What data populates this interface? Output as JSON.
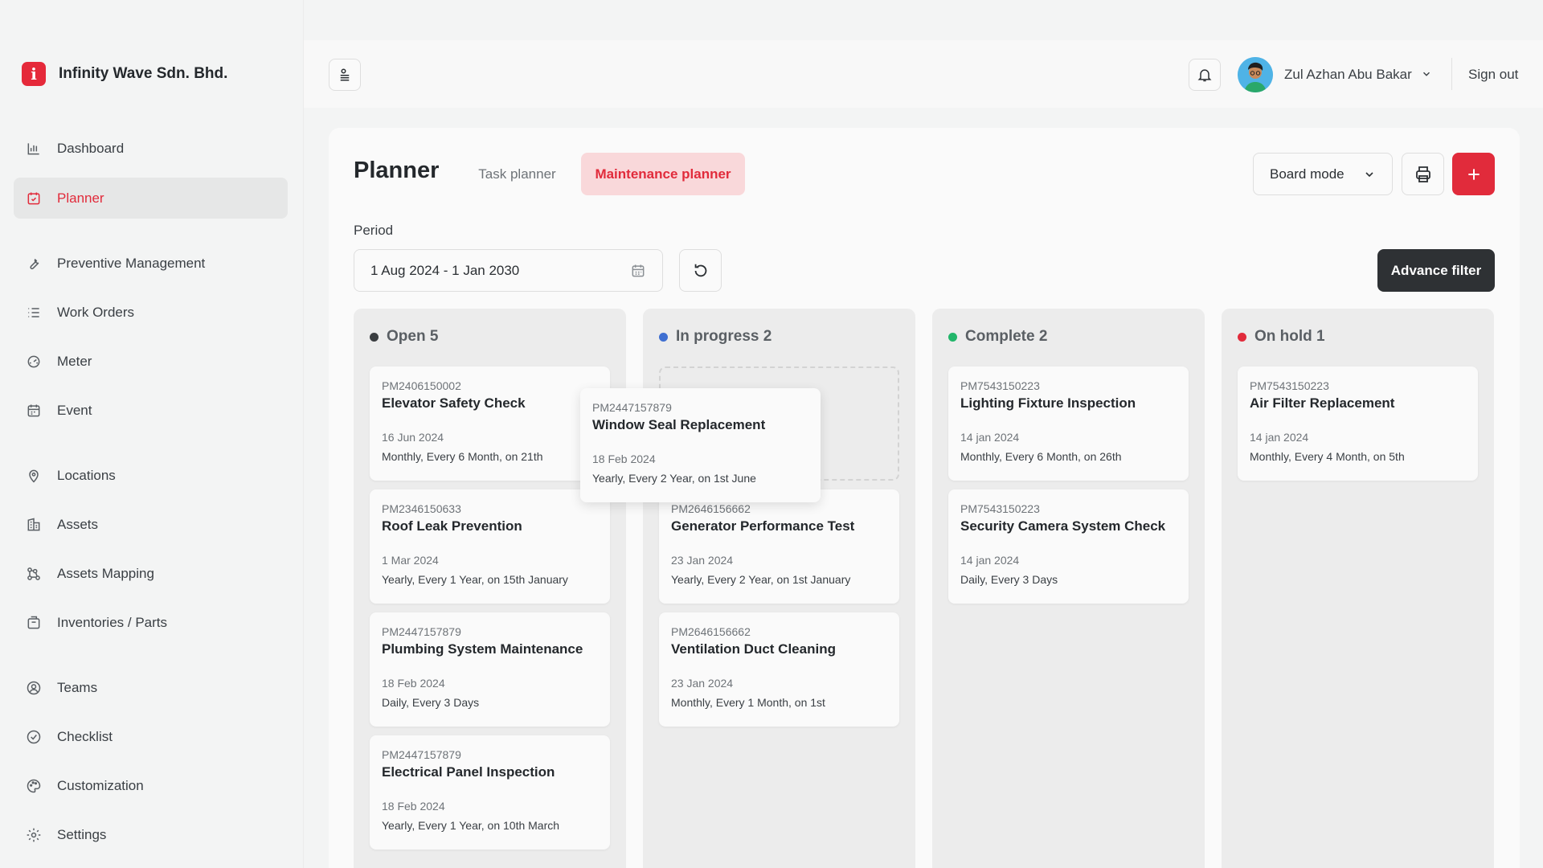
{
  "brand": {
    "name": "Infinity Wave Sdn. Bhd.",
    "logo_letter": "i",
    "color": "#e5293a"
  },
  "sidebar": {
    "items": [
      {
        "label": "Dashboard",
        "icon": "bar-chart-icon"
      },
      {
        "label": "Planner",
        "icon": "calendar-check-icon",
        "active": true
      },
      {
        "label": "Preventive Management",
        "icon": "wrench-icon"
      },
      {
        "label": "Work Orders",
        "icon": "list-icon"
      },
      {
        "label": "Meter",
        "icon": "gauge-icon"
      },
      {
        "label": "Event",
        "icon": "calendar-icon"
      },
      {
        "label": "Locations",
        "icon": "map-pin-icon"
      },
      {
        "label": "Assets",
        "icon": "building-icon"
      },
      {
        "label": "Assets Mapping",
        "icon": "network-icon"
      },
      {
        "label": "Inventories / Parts",
        "icon": "box-icon"
      },
      {
        "label": "Teams",
        "icon": "user-circle-icon"
      },
      {
        "label": "Checklist",
        "icon": "check-circle-icon"
      },
      {
        "label": "Customization",
        "icon": "palette-icon"
      },
      {
        "label": "Settings",
        "icon": "gear-icon"
      }
    ]
  },
  "header": {
    "user_name": "Zul Azhan Abu Bakar",
    "sign_out": "Sign out"
  },
  "planner": {
    "title": "Planner",
    "tabs": [
      {
        "label": "Task planner",
        "active": false
      },
      {
        "label": "Maintenance planner",
        "active": true
      }
    ],
    "board_mode": "Board mode",
    "period_label": "Period",
    "period_value": "1 Aug 2024 - 1 Jan 2030",
    "advance_filter": "Advance filter"
  },
  "board": {
    "columns": [
      {
        "title": "Open 5",
        "color": "#3a3d40",
        "cards": [
          {
            "code": "PM2406150002",
            "title": "Elevator Safety Check",
            "date": "16 Jun 2024",
            "schedule": "Monthly, Every 6 Month, on 21th"
          },
          {
            "code": "PM2346150633",
            "title": "Roof Leak Prevention",
            "date": "1 Mar 2024",
            "schedule": "Yearly, Every 1 Year, on 15th January"
          },
          {
            "code": "PM2447157879",
            "title": "Plumbing System Maintenance",
            "date": "18 Feb 2024",
            "schedule": "Daily, Every 3 Days"
          },
          {
            "code": "PM2447157879",
            "title": "Electrical Panel Inspection",
            "date": "18 Feb 2024",
            "schedule": "Yearly, Every 1 Year, on 10th March"
          }
        ]
      },
      {
        "title": "In progress 2",
        "color": "#3f6fd1",
        "cards": [
          {
            "code": "PM2646156662",
            "title": "Generator Performance Test",
            "date": "23 Jan 2024",
            "schedule": "Yearly, Every 2 Year, on 1st January"
          },
          {
            "code": "PM2646156662",
            "title": "Ventilation Duct Cleaning",
            "date": "23 Jan 2024",
            "schedule": "Monthly, Every 1 Month, on 1st"
          }
        ]
      },
      {
        "title": "Complete 2",
        "color": "#22b66a",
        "cards": [
          {
            "code": "PM7543150223",
            "title": "Lighting Fixture Inspection",
            "date": "14 jan 2024",
            "schedule": "Monthly, Every 6 Month, on 26th"
          },
          {
            "code": "PM7543150223",
            "title": "Security Camera System Check",
            "date": "14 jan 2024",
            "schedule": "Daily, Every 3 Days"
          }
        ]
      },
      {
        "title": "On hold 1",
        "color": "#e12b3b",
        "cards": [
          {
            "code": "PM7543150223",
            "title": "Air Filter Replacement",
            "date": "14 jan 2024",
            "schedule": "Monthly, Every 4 Month, on 5th"
          }
        ]
      }
    ],
    "dragging_card": {
      "code": "PM2447157879",
      "title": "Window Seal Replacement",
      "date": "18 Feb 2024",
      "schedule": "Yearly, Every 2 Year, on 1st June"
    }
  }
}
